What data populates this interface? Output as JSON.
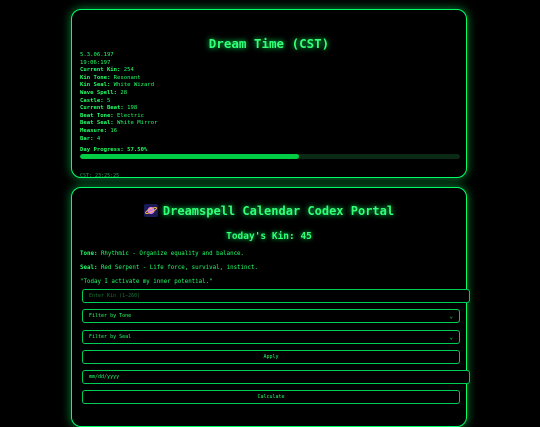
{
  "time_card": {
    "title": "Dream Time (CST)",
    "lines": [
      {
        "k": "",
        "v": "5.3.06.197"
      },
      {
        "k": "",
        "v": "19:06:197"
      },
      {
        "k": "Current Kin:",
        "v": " 254"
      },
      {
        "k": "Kin Tone:",
        "v": " Resonant"
      },
      {
        "k": "Kin Seal:",
        "v": " White Wizard"
      },
      {
        "k": "Wave Spell:",
        "v": " 28"
      },
      {
        "k": "Castle:",
        "v": " 5"
      },
      {
        "k": "Current Beat:",
        "v": " 198"
      },
      {
        "k": "Beat Tone:",
        "v": " Electric"
      },
      {
        "k": "Beat Seal:",
        "v": " White Mirror"
      },
      {
        "k": "Measure:",
        "v": " 16"
      },
      {
        "k": "Bar:",
        "v": " 4"
      }
    ],
    "progress_label": "Day Progress:",
    "progress_value": "57.50%",
    "progress_fraction": 0.575,
    "clock": "CST: 23:25:25"
  },
  "portal": {
    "title": "Dreamspell Calendar Codex Portal",
    "planet_icon": "ringed-planet-emoji",
    "kin_heading": "Today's Kin: 45",
    "tone_label": "Tone:",
    "tone_text": " Rhythmic - Organize equality and balance.",
    "seal_label": "Seal:",
    "seal_text": " Red Serpent - Life force, survival, instinct.",
    "affirmation": "\"Today I activate my inner potential.\"",
    "kin_input_placeholder": "Enter Kin (1–260)",
    "tone_filter": "Filter by Tone",
    "seal_filter": "Filter by Seal",
    "apply_label": "Apply",
    "date_placeholder": "mm/dd/yyyy",
    "calculate_label": "Calculate"
  },
  "colors": {
    "accent": "#00ff66",
    "background": "#000000"
  }
}
